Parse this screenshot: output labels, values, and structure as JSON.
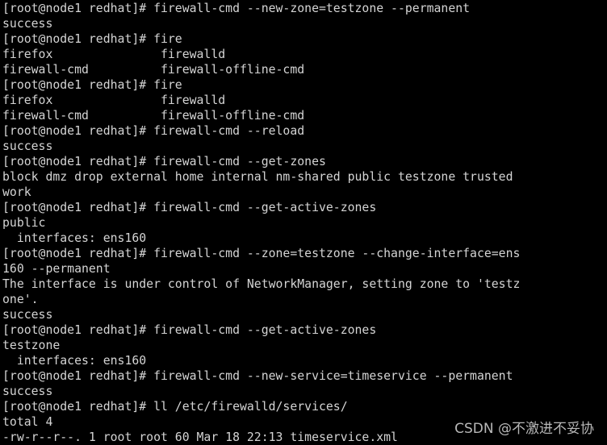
{
  "terminal": {
    "lines": [
      "[root@node1 redhat]# firewall-cmd --new-zone=testzone --permanent",
      "success",
      "[root@node1 redhat]# fire",
      "firefox               firewalld",
      "firewall-cmd          firewall-offline-cmd",
      "[root@node1 redhat]# fire",
      "firefox               firewalld",
      "firewall-cmd          firewall-offline-cmd",
      "[root@node1 redhat]# firewall-cmd --reload",
      "success",
      "[root@node1 redhat]# firewall-cmd --get-zones",
      "block dmz drop external home internal nm-shared public testzone trusted",
      "work",
      "[root@node1 redhat]# firewall-cmd --get-active-zones",
      "public",
      "  interfaces: ens160",
      "[root@node1 redhat]# firewall-cmd --zone=testzone --change-interface=ens",
      "160 --permanent",
      "The interface is under control of NetworkManager, setting zone to 'testz",
      "one'.",
      "success",
      "[root@node1 redhat]# firewall-cmd --get-active-zones",
      "testzone",
      "  interfaces: ens160",
      "[root@node1 redhat]# firewall-cmd --new-service=timeservice --permanent",
      "success",
      "[root@node1 redhat]# ll /etc/firewalld/services/",
      "total 4",
      "-rw-r--r--. 1 root root 60 Mar 18 22:13 timeservice.xml"
    ]
  },
  "watermark": "CSDN @不激进不妥协",
  "colors": {
    "background": "#000000",
    "text": "#d4d4d4"
  }
}
